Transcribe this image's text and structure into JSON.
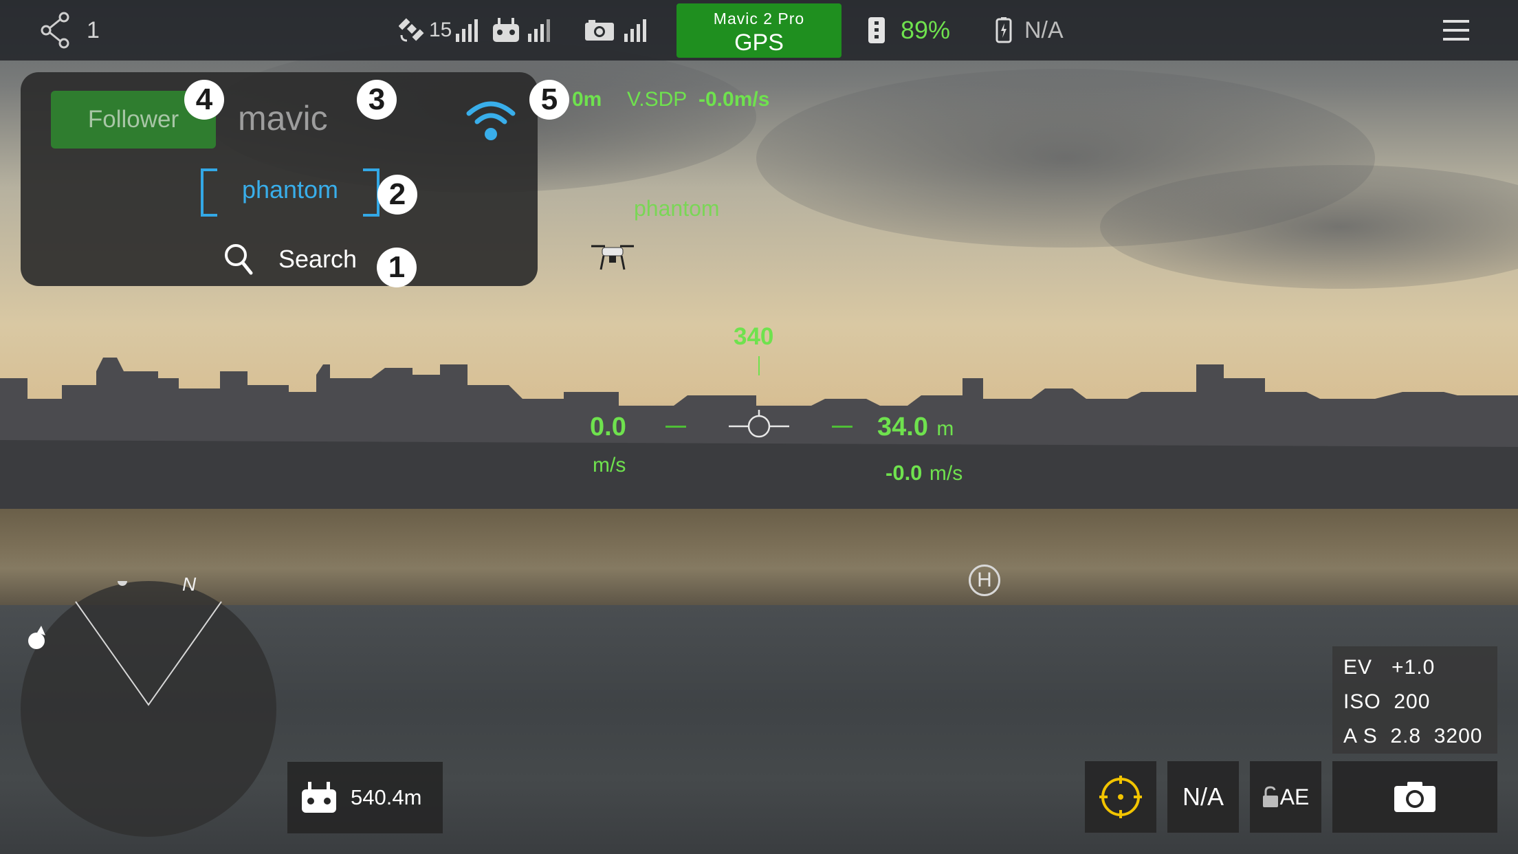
{
  "topbar": {
    "share_count": "1",
    "satellite_count": "15",
    "aircraft_model": "Mavic 2 Pro",
    "flight_mode": "GPS",
    "aircraft_battery": "89%",
    "phone_battery": "N/A",
    "icons": [
      "share-icon",
      "satellite-icon",
      "signal-bars-icon",
      "remote-controller-icon",
      "camera-icon",
      "battery-icon",
      "phone-battery-icon",
      "menu-icon"
    ]
  },
  "panel": {
    "follower_label": "Follower",
    "mavic_label": "mavic",
    "phantom_label": "phantom",
    "search_label": "Search",
    "badges": [
      "1",
      "2",
      "3",
      "4",
      "5"
    ],
    "accent_color": "#39aeea"
  },
  "hud": {
    "partial_height": "0m",
    "vsdp_label": "V.SDP",
    "vsdp_value": "-0.0m/s",
    "target_label": "phantom",
    "heading": "340",
    "hspeed": "0.0",
    "hspeed_unit": "m/s",
    "altitude": "34.0",
    "altitude_unit": "m",
    "vspeed": "-0.0",
    "vspeed_unit": "m/s",
    "home_label": "H",
    "color": "#6fe24e"
  },
  "radar": {
    "north": "N"
  },
  "bottom": {
    "rc_distance": "540.4m",
    "ev": "EV   +1.0",
    "iso": "ISO  200",
    "aperture_shutter": "A S  2.8  3200",
    "na_button": "N/A",
    "ae_lock_label": "AE"
  }
}
